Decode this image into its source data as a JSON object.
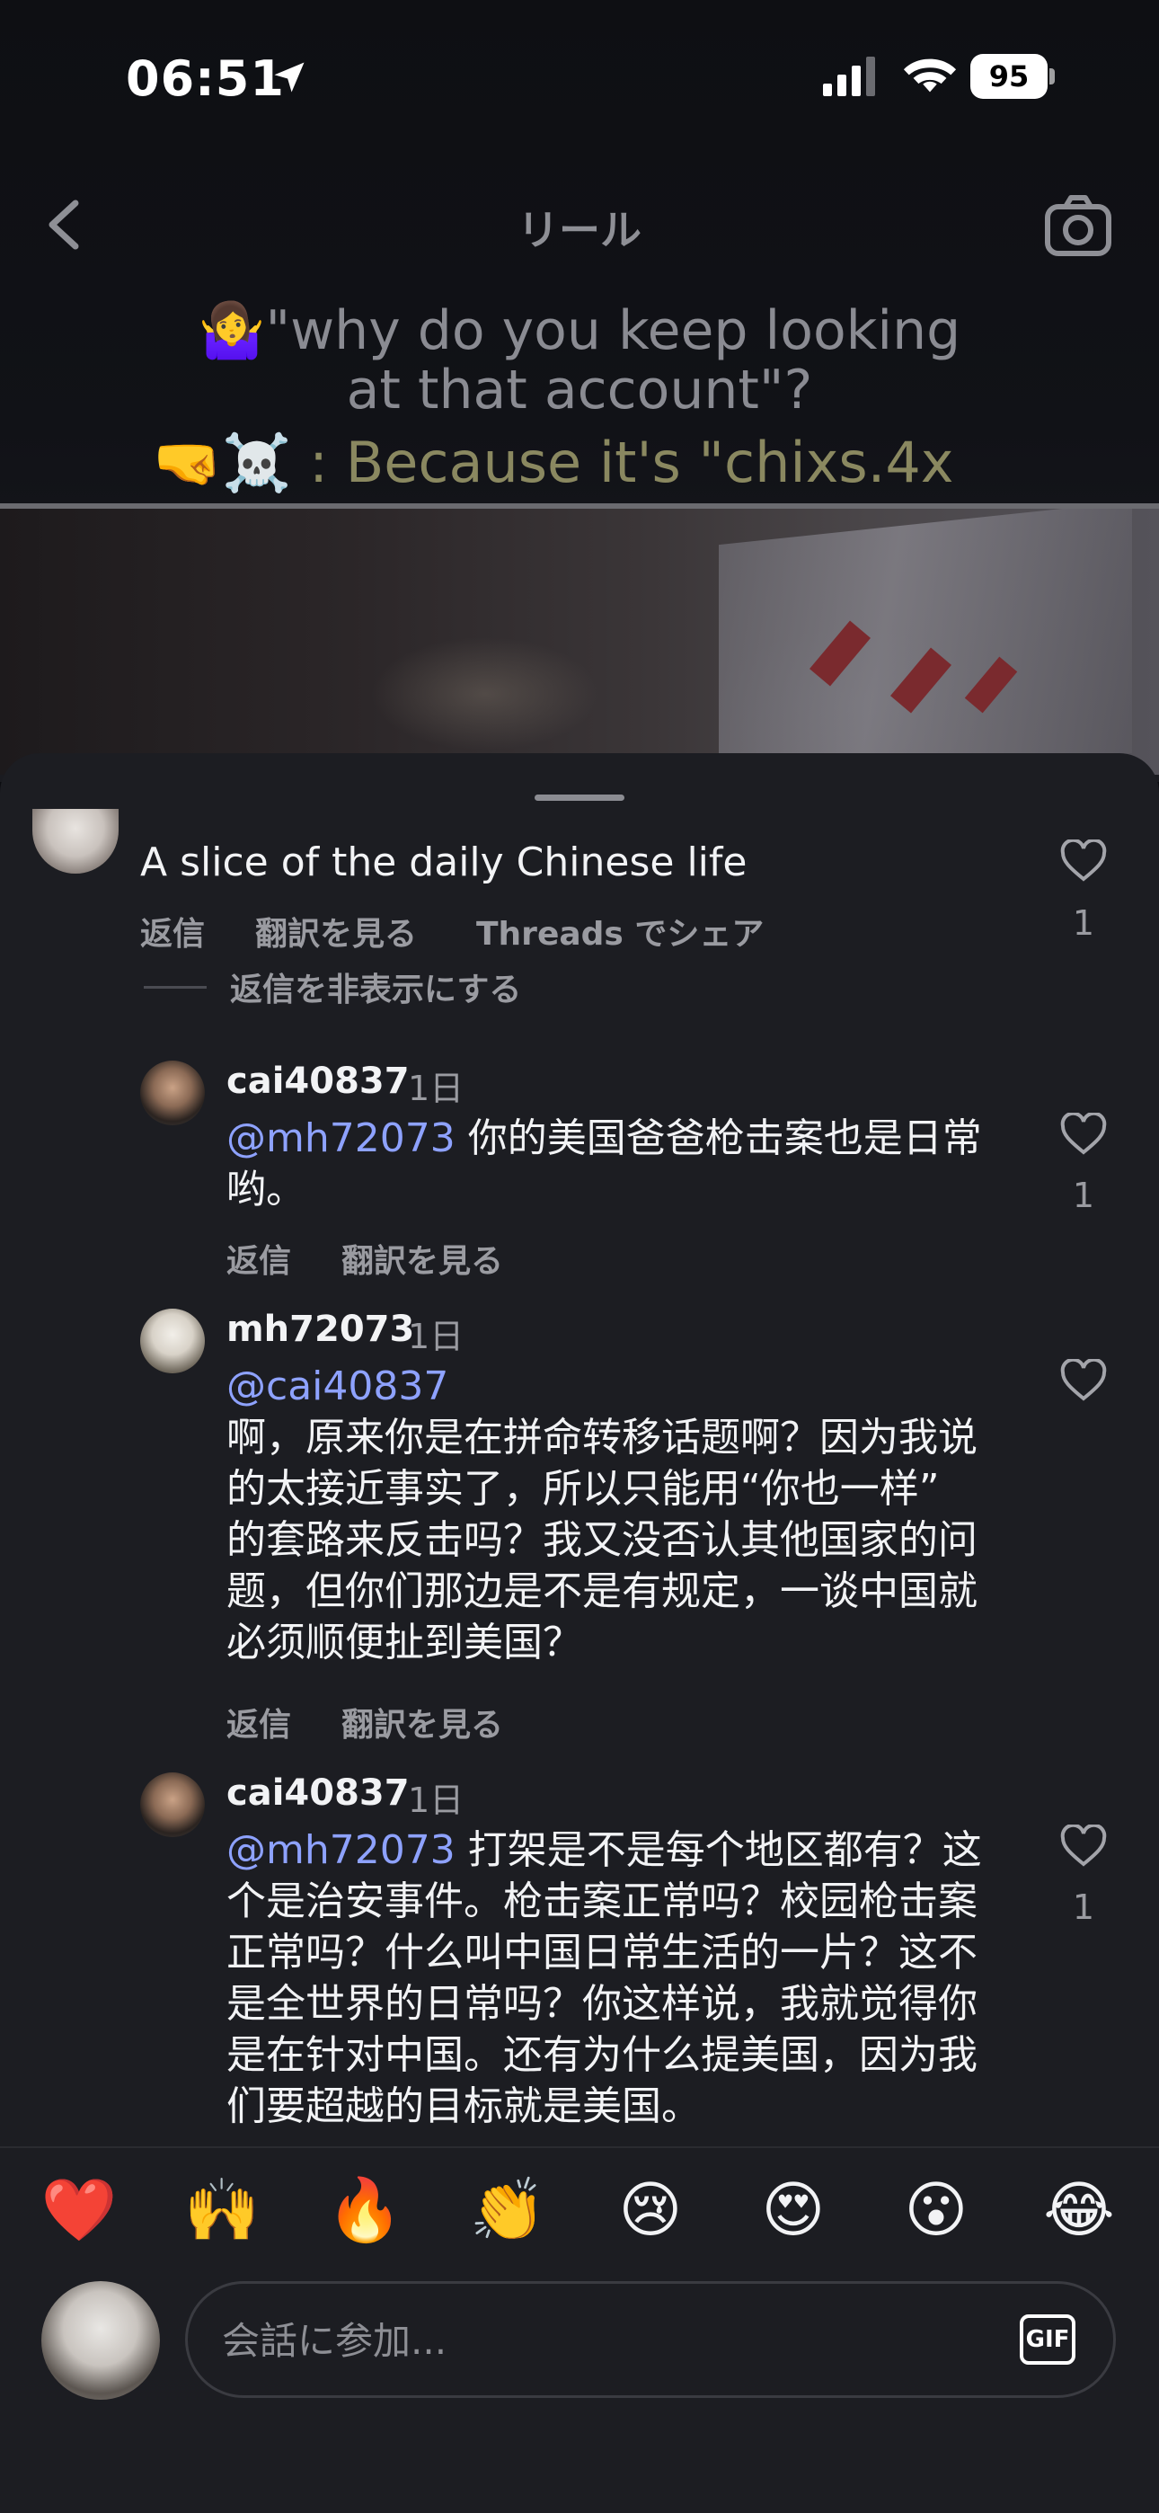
{
  "status_bar": {
    "time": "06:51",
    "battery": "95"
  },
  "header": {
    "title": "リール"
  },
  "video_overlay": {
    "line1": "🤷‍♀️\"why  do you  keep looking",
    "line2": "at that account\"?",
    "line3": "🤜☠️ : Because it's \"chixs.4x"
  },
  "top_comment": {
    "text": "A slice of the daily Chinese life",
    "actions": {
      "reply": "返信",
      "translate": "翻訳を見る",
      "share": "Threads でシェア"
    },
    "likes": "1",
    "hide_replies": "返信を非表示にする"
  },
  "replies": [
    {
      "user": "cai40837",
      "time": "1日",
      "mention": "@mh72073",
      "lines": [
        "你的美国爸爸枪击案也是日常",
        "哟。"
      ],
      "likes": "1",
      "reply": "返信",
      "translate": "翻訳を見る"
    },
    {
      "user": "mh72073",
      "time": "1日",
      "mention": "@cai40837",
      "lines": [
        "啊，原来你是在拼命转移话题啊？因为我说",
        "的太接近事实了，所以只能用“你也一样”",
        "的套路来反击吗？我又没否认其他国家的问",
        "题，但你们那边是不是有规定，一谈中国就",
        "必须顺便扯到美国？"
      ],
      "likes": "",
      "reply": "返信",
      "translate": "翻訳を見る"
    },
    {
      "user": "cai40837",
      "time": "1日",
      "mention": "@mh72073",
      "lines": [
        "打架是不是每个地区都有？这",
        "个是治安事件。枪击案正常吗？校园枪击案",
        "正常吗？什么叫中国日常生活的一片？这不",
        "是全世界的日常吗？你这样说，我就觉得你",
        "是在针对中国。还有为什么提美国，因为我",
        "们要超越的目标就是美国。"
      ],
      "likes": "1"
    }
  ],
  "emoji_bar": [
    "❤️",
    "🙌",
    "🔥",
    "👏",
    "😢",
    "😍",
    "😮",
    "😂"
  ],
  "composer": {
    "placeholder": "会話に参加...",
    "gif_label": "GIF"
  },
  "colors": {
    "sheet": "#1c1d22",
    "mention": "#8ea2ff",
    "muted": "#9a9ba1"
  }
}
